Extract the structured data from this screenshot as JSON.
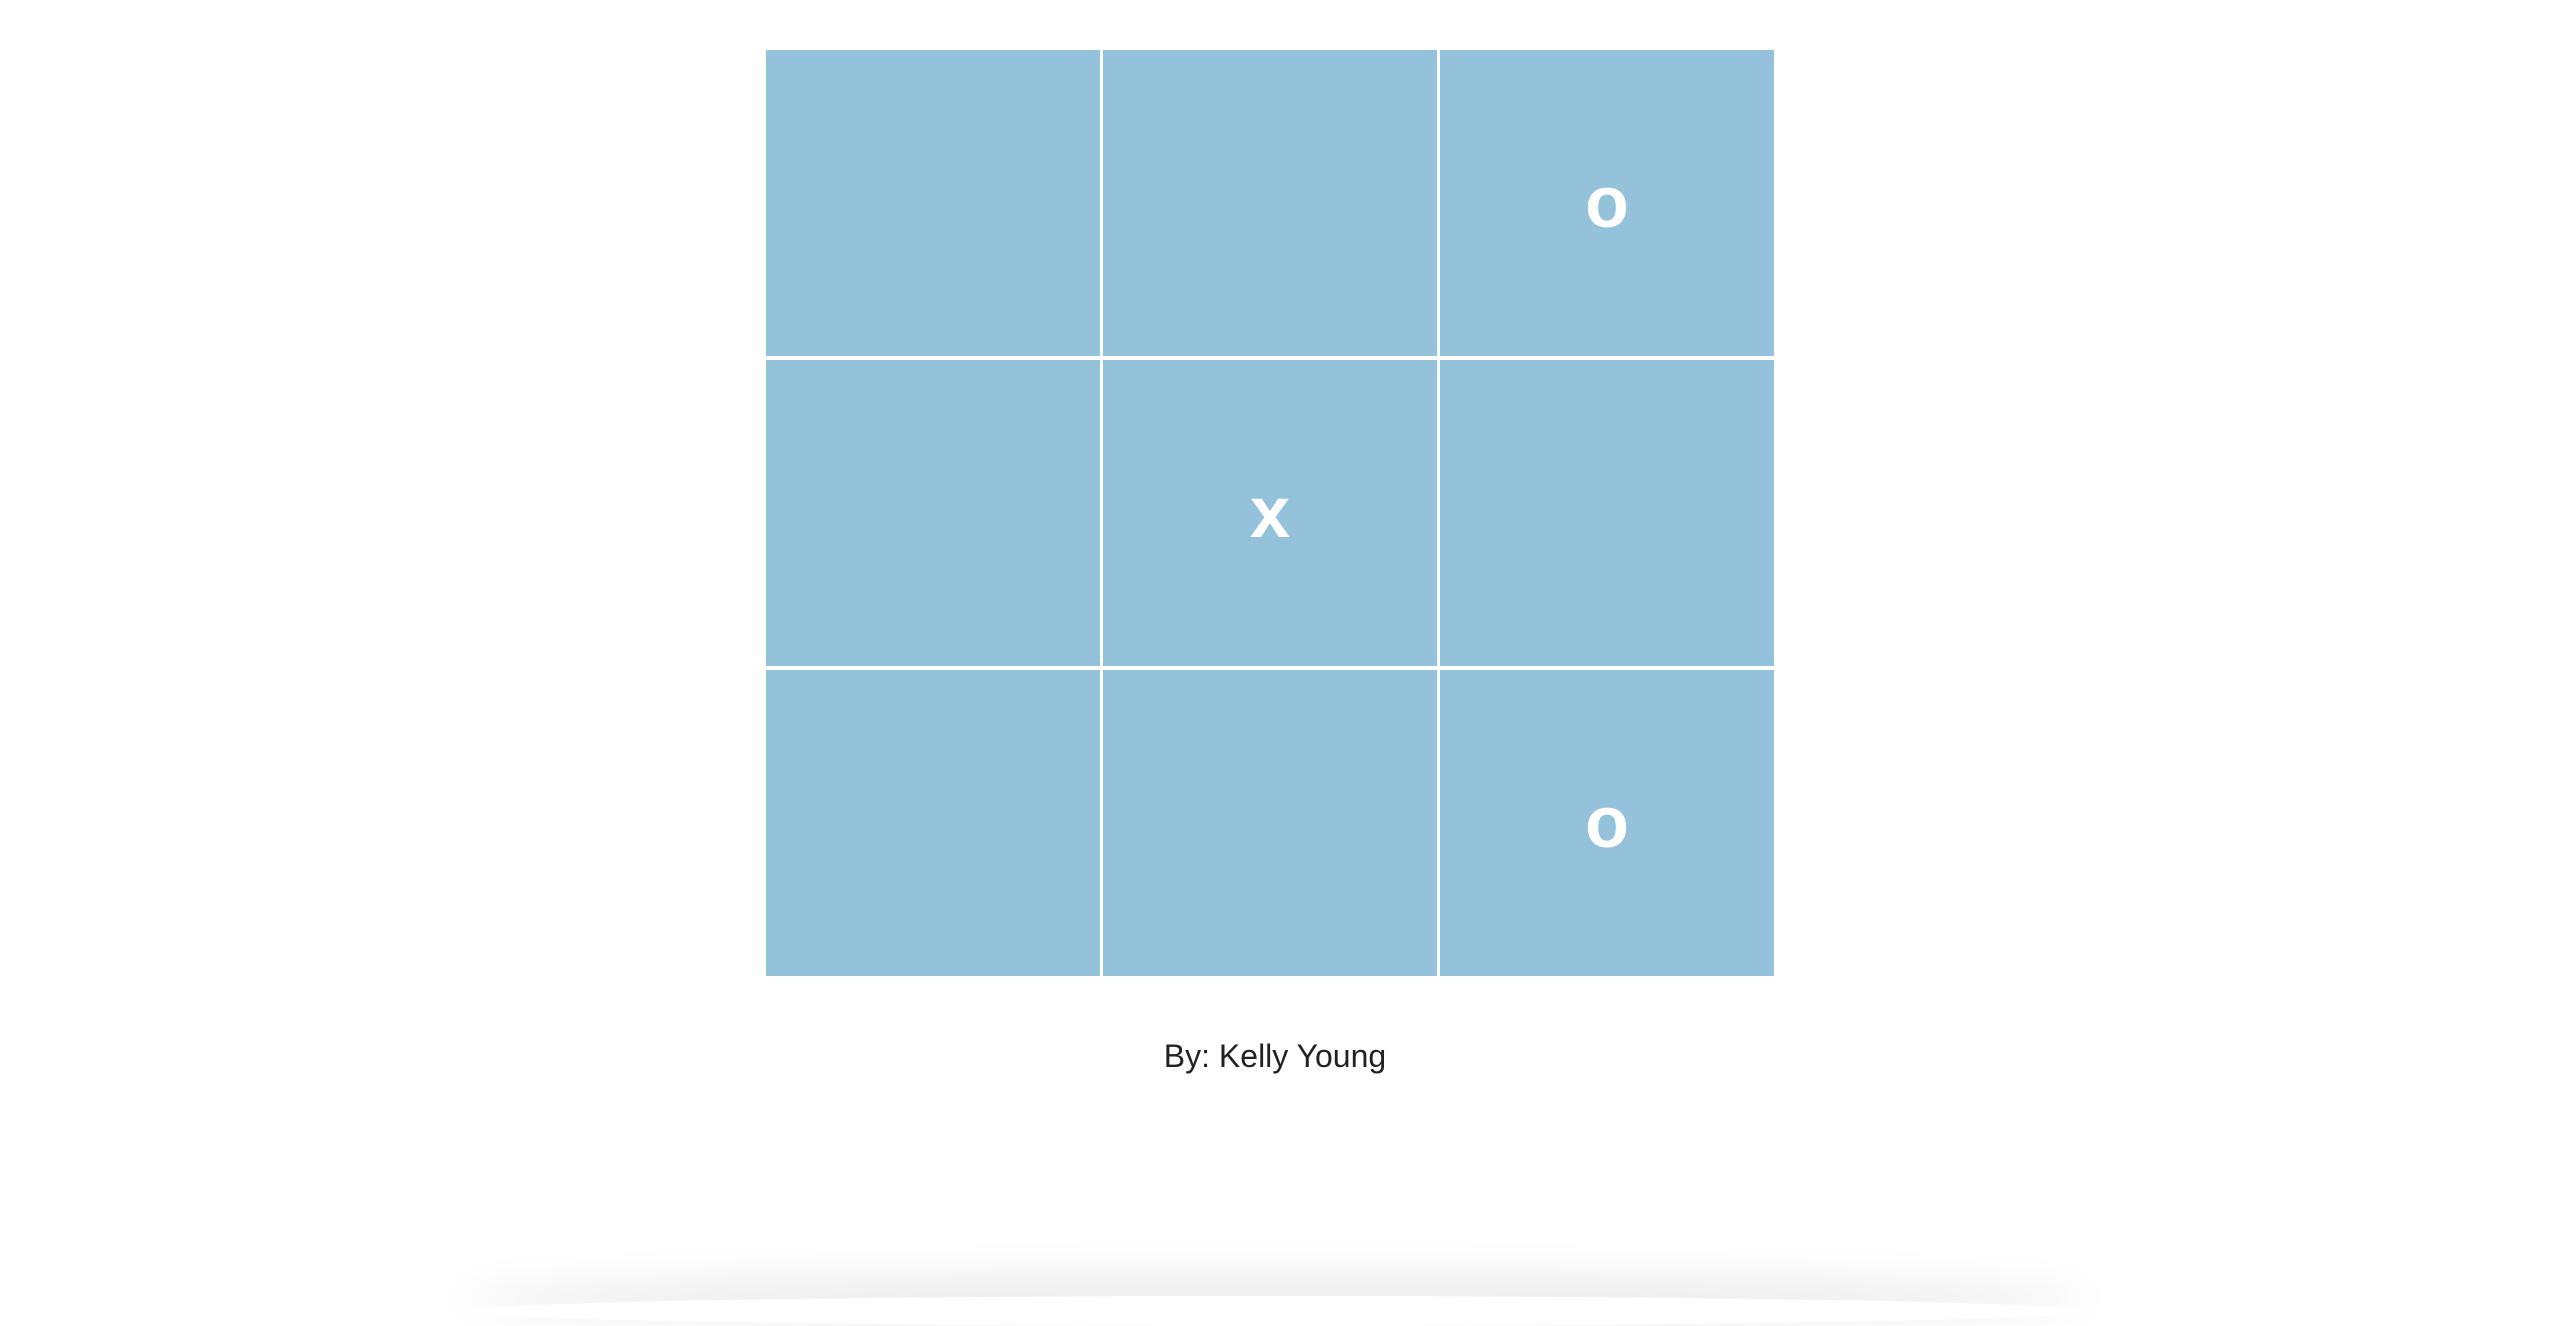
{
  "board": {
    "cell_color": "#93c2da",
    "mark_color": "#ffffff",
    "cells": [
      "",
      "",
      "o",
      "",
      "x",
      "",
      "",
      "",
      "o"
    ]
  },
  "footer": {
    "author": "By: Kelly Young"
  }
}
